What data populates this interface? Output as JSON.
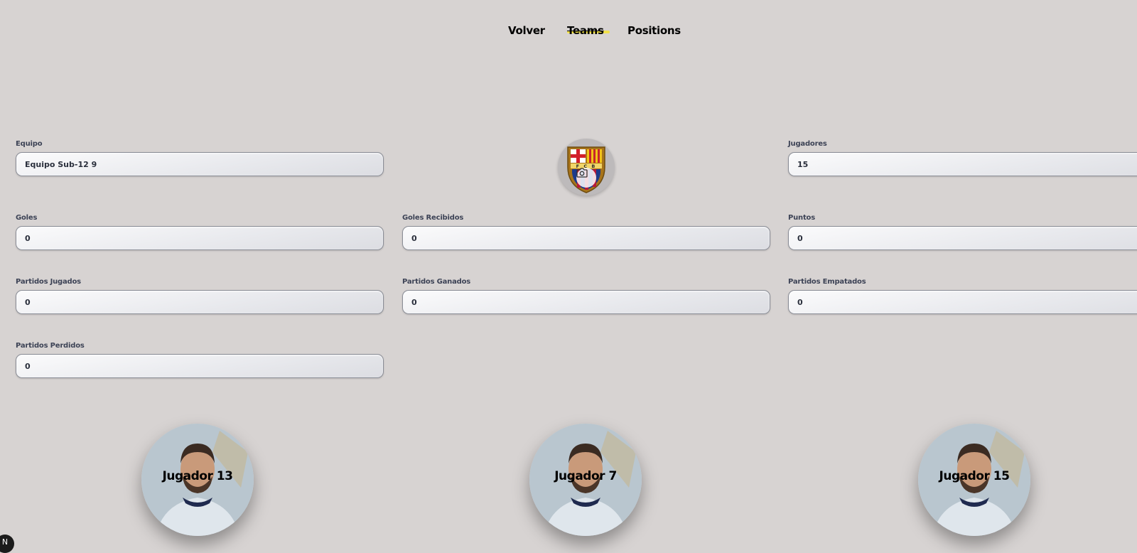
{
  "nav": {
    "back_label": "Volver",
    "teams_label": "Teams",
    "positions_label": "Positions"
  },
  "team": {
    "badge_text": "FCB",
    "fields": {
      "equipo": {
        "label": "Equipo",
        "value": "Equipo Sub-12 9"
      },
      "jugadores": {
        "label": "Jugadores",
        "value": "15"
      },
      "goles": {
        "label": "Goles",
        "value": "0"
      },
      "goles_recibidos": {
        "label": "Goles Recibidos",
        "value": "0"
      },
      "puntos": {
        "label": "Puntos",
        "value": "0"
      },
      "partidos_jugados": {
        "label": "Partidos Jugados",
        "value": "0"
      },
      "partidos_ganados": {
        "label": "Partidos Ganados",
        "value": "0"
      },
      "partidos_empatados": {
        "label": "Partidos Empatados",
        "value": "0"
      },
      "partidos_perdidos": {
        "label": "Partidos Perdidos",
        "value": "0"
      }
    }
  },
  "players": [
    {
      "name": "Jugador 13"
    },
    {
      "name": "Jugador 7"
    },
    {
      "name": "Jugador 15"
    }
  ],
  "corner_badge": "N",
  "colors": {
    "background": "#d7d3d2",
    "active_underline": "#f1e04a",
    "label_text": "#3d4356"
  },
  "icons": [
    "camera-icon",
    "fcb-crest-icon"
  ]
}
